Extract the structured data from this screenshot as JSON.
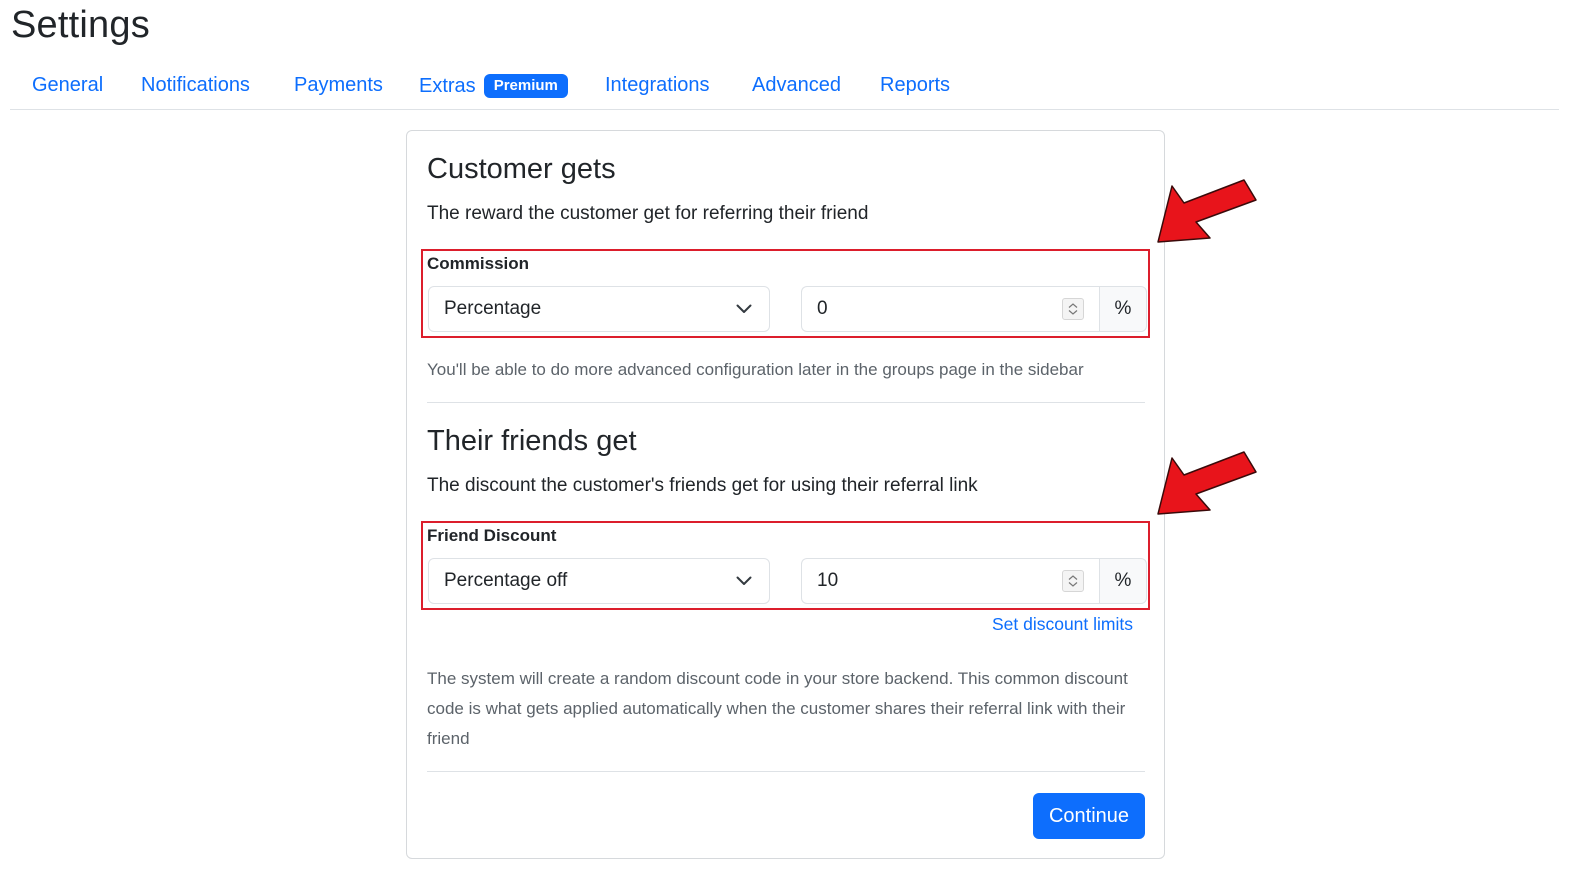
{
  "page": {
    "title": "Settings"
  },
  "tabs": [
    {
      "label": "General"
    },
    {
      "label": "Notifications"
    },
    {
      "label": "Payments"
    },
    {
      "label": "Extras",
      "badge": "Premium"
    },
    {
      "label": "Integrations"
    },
    {
      "label": "Advanced"
    },
    {
      "label": "Reports"
    }
  ],
  "customer": {
    "heading": "Customer gets",
    "description": "The reward the customer get for referring their friend",
    "field_label": "Commission",
    "type_value": "Percentage",
    "amount_value": "0",
    "unit": "%",
    "help": "You'll be able to do more advanced configuration later in the groups page in the sidebar"
  },
  "friends": {
    "heading": "Their friends get",
    "description": "The discount the customer's friends get for using their referral link",
    "field_label": "Friend Discount",
    "type_value": "Percentage off",
    "amount_value": "10",
    "unit": "%",
    "limits_link": "Set discount limits",
    "help": "The system will create a random discount code in your store backend. This common discount code is what gets applied automatically when the customer shares their referral link with their friend"
  },
  "actions": {
    "continue_label": "Continue"
  },
  "colors": {
    "accent": "#0d6efd",
    "annotation": "#e8141b",
    "highlight": "#dc1e2c"
  },
  "icons": {
    "select_toggle": "chevron-down-icon",
    "stepper": "spinner-icon",
    "annotation": "red-arrow-icon"
  }
}
